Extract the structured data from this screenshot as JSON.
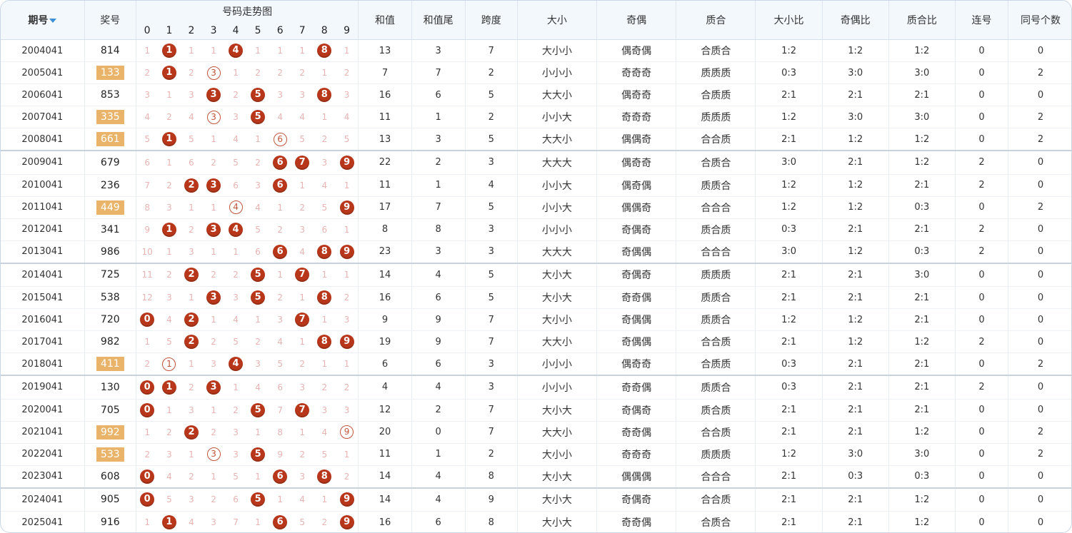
{
  "headers": {
    "period": "期号",
    "prize": "奖号",
    "trend": "号码走势图",
    "digits": [
      "0",
      "1",
      "2",
      "3",
      "4",
      "5",
      "6",
      "7",
      "8",
      "9"
    ],
    "sum": "和值",
    "sum_tail": "和值尾",
    "span": "跨度",
    "big_small": "大小",
    "odd_even": "奇偶",
    "prime_composite": "质合",
    "big_small_ratio": "大小比",
    "odd_even_ratio": "奇偶比",
    "prime_ratio": "质合比",
    "consecutive": "连号",
    "same_count": "同号个数"
  },
  "colors": {
    "ball": "#b8371a",
    "prize_highlight": "#e9b469",
    "header_bg": "#f3f8fd",
    "miss_text": "#e8b3b3"
  },
  "rows": [
    {
      "period": "2004041",
      "prize": "814",
      "hl": false,
      "cells": [
        "1",
        "1",
        "1",
        "1",
        "4",
        "1",
        "1",
        "1",
        "8",
        "1"
      ],
      "sum": "13",
      "tail": "3",
      "span": "7",
      "bs": "大小小",
      "oe": "偶奇偶",
      "pc": "合质合",
      "bsr": "1:2",
      "oer": "1:2",
      "pcr": "1:2",
      "cons": "0",
      "same": "0"
    },
    {
      "period": "2005041",
      "prize": "133",
      "hl": true,
      "cells": [
        "2",
        "1",
        "2",
        "3",
        "1",
        "2",
        "2",
        "2",
        "1",
        "2"
      ],
      "sum": "7",
      "tail": "7",
      "span": "2",
      "bs": "小小小",
      "oe": "奇奇奇",
      "pc": "质质质",
      "bsr": "0:3",
      "oer": "3:0",
      "pcr": "3:0",
      "cons": "0",
      "same": "2"
    },
    {
      "period": "2006041",
      "prize": "853",
      "hl": false,
      "cells": [
        "3",
        "1",
        "3",
        "3",
        "2",
        "5",
        "3",
        "3",
        "8",
        "3"
      ],
      "sum": "16",
      "tail": "6",
      "span": "5",
      "bs": "大大小",
      "oe": "偶奇奇",
      "pc": "合质质",
      "bsr": "2:1",
      "oer": "2:1",
      "pcr": "2:1",
      "cons": "0",
      "same": "0"
    },
    {
      "period": "2007041",
      "prize": "335",
      "hl": true,
      "cells": [
        "4",
        "2",
        "4",
        "3",
        "3",
        "5",
        "4",
        "4",
        "1",
        "4"
      ],
      "sum": "11",
      "tail": "1",
      "span": "2",
      "bs": "小小大",
      "oe": "奇奇奇",
      "pc": "质质质",
      "bsr": "1:2",
      "oer": "3:0",
      "pcr": "3:0",
      "cons": "0",
      "same": "2"
    },
    {
      "period": "2008041",
      "prize": "661",
      "hl": true,
      "cells": [
        "5",
        "1",
        "5",
        "1",
        "4",
        "1",
        "6",
        "5",
        "2",
        "5"
      ],
      "sum": "13",
      "tail": "3",
      "span": "5",
      "bs": "大大小",
      "oe": "偶偶奇",
      "pc": "合合质",
      "bsr": "2:1",
      "oer": "1:2",
      "pcr": "1:2",
      "cons": "0",
      "same": "2"
    },
    {
      "period": "2009041",
      "prize": "679",
      "hl": false,
      "cells": [
        "6",
        "1",
        "6",
        "2",
        "5",
        "2",
        "6",
        "7",
        "3",
        "9"
      ],
      "sum": "22",
      "tail": "2",
      "span": "3",
      "bs": "大大大",
      "oe": "偶奇奇",
      "pc": "合质合",
      "bsr": "3:0",
      "oer": "2:1",
      "pcr": "1:2",
      "cons": "2",
      "same": "0"
    },
    {
      "period": "2010041",
      "prize": "236",
      "hl": false,
      "cells": [
        "7",
        "2",
        "2",
        "3",
        "6",
        "3",
        "6",
        "1",
        "4",
        "1"
      ],
      "sum": "11",
      "tail": "1",
      "span": "4",
      "bs": "小小大",
      "oe": "偶奇偶",
      "pc": "质质合",
      "bsr": "1:2",
      "oer": "1:2",
      "pcr": "2:1",
      "cons": "2",
      "same": "0"
    },
    {
      "period": "2011041",
      "prize": "449",
      "hl": true,
      "cells": [
        "8",
        "3",
        "1",
        "1",
        "4",
        "4",
        "1",
        "2",
        "5",
        "9"
      ],
      "sum": "17",
      "tail": "7",
      "span": "5",
      "bs": "小小大",
      "oe": "偶偶奇",
      "pc": "合合合",
      "bsr": "1:2",
      "oer": "1:2",
      "pcr": "0:3",
      "cons": "0",
      "same": "2"
    },
    {
      "period": "2012041",
      "prize": "341",
      "hl": false,
      "cells": [
        "9",
        "1",
        "2",
        "3",
        "4",
        "5",
        "2",
        "3",
        "6",
        "1"
      ],
      "sum": "8",
      "tail": "8",
      "span": "3",
      "bs": "小小小",
      "oe": "奇偶奇",
      "pc": "质合质",
      "bsr": "0:3",
      "oer": "2:1",
      "pcr": "2:1",
      "cons": "2",
      "same": "0"
    },
    {
      "period": "2013041",
      "prize": "986",
      "hl": false,
      "cells": [
        "10",
        "1",
        "3",
        "1",
        "1",
        "6",
        "6",
        "4",
        "8",
        "9"
      ],
      "sum": "23",
      "tail": "3",
      "span": "3",
      "bs": "大大大",
      "oe": "奇偶偶",
      "pc": "合合合",
      "bsr": "3:0",
      "oer": "1:2",
      "pcr": "0:3",
      "cons": "2",
      "same": "0"
    },
    {
      "period": "2014041",
      "prize": "725",
      "hl": false,
      "cells": [
        "11",
        "2",
        "2",
        "2",
        "2",
        "5",
        "1",
        "7",
        "1",
        "1"
      ],
      "sum": "14",
      "tail": "4",
      "span": "5",
      "bs": "大小大",
      "oe": "奇偶奇",
      "pc": "质质质",
      "bsr": "2:1",
      "oer": "2:1",
      "pcr": "3:0",
      "cons": "0",
      "same": "0"
    },
    {
      "period": "2015041",
      "prize": "538",
      "hl": false,
      "cells": [
        "12",
        "3",
        "1",
        "3",
        "3",
        "5",
        "2",
        "1",
        "8",
        "2"
      ],
      "sum": "16",
      "tail": "6",
      "span": "5",
      "bs": "大小大",
      "oe": "奇奇偶",
      "pc": "质质合",
      "bsr": "2:1",
      "oer": "2:1",
      "pcr": "2:1",
      "cons": "0",
      "same": "0"
    },
    {
      "period": "2016041",
      "prize": "720",
      "hl": false,
      "cells": [
        "0",
        "4",
        "2",
        "1",
        "4",
        "1",
        "3",
        "7",
        "1",
        "3"
      ],
      "sum": "9",
      "tail": "9",
      "span": "7",
      "bs": "大小小",
      "oe": "奇偶偶",
      "pc": "质质合",
      "bsr": "1:2",
      "oer": "1:2",
      "pcr": "2:1",
      "cons": "0",
      "same": "0"
    },
    {
      "period": "2017041",
      "prize": "982",
      "hl": false,
      "cells": [
        "1",
        "5",
        "2",
        "2",
        "5",
        "2",
        "4",
        "1",
        "8",
        "9"
      ],
      "sum": "19",
      "tail": "9",
      "span": "7",
      "bs": "大大小",
      "oe": "奇偶偶",
      "pc": "合合质",
      "bsr": "2:1",
      "oer": "1:2",
      "pcr": "1:2",
      "cons": "2",
      "same": "0"
    },
    {
      "period": "2018041",
      "prize": "411",
      "hl": true,
      "cells": [
        "2",
        "1",
        "1",
        "3",
        "4",
        "3",
        "5",
        "2",
        "1",
        "1"
      ],
      "sum": "6",
      "tail": "6",
      "span": "3",
      "bs": "小小小",
      "oe": "偶奇奇",
      "pc": "合质质",
      "bsr": "0:3",
      "oer": "2:1",
      "pcr": "2:1",
      "cons": "0",
      "same": "2"
    },
    {
      "period": "2019041",
      "prize": "130",
      "hl": false,
      "cells": [
        "0",
        "1",
        "2",
        "3",
        "1",
        "4",
        "6",
        "3",
        "2",
        "2"
      ],
      "sum": "4",
      "tail": "4",
      "span": "3",
      "bs": "小小小",
      "oe": "奇奇偶",
      "pc": "质质合",
      "bsr": "0:3",
      "oer": "2:1",
      "pcr": "2:1",
      "cons": "2",
      "same": "0"
    },
    {
      "period": "2020041",
      "prize": "705",
      "hl": false,
      "cells": [
        "0",
        "1",
        "3",
        "1",
        "2",
        "5",
        "7",
        "7",
        "3",
        "3"
      ],
      "sum": "12",
      "tail": "2",
      "span": "7",
      "bs": "大小大",
      "oe": "奇偶奇",
      "pc": "质合质",
      "bsr": "2:1",
      "oer": "2:1",
      "pcr": "2:1",
      "cons": "0",
      "same": "0"
    },
    {
      "period": "2021041",
      "prize": "992",
      "hl": true,
      "cells": [
        "1",
        "2",
        "2",
        "2",
        "3",
        "1",
        "8",
        "1",
        "4",
        "9"
      ],
      "sum": "20",
      "tail": "0",
      "span": "7",
      "bs": "大大小",
      "oe": "奇奇偶",
      "pc": "合合质",
      "bsr": "2:1",
      "oer": "2:1",
      "pcr": "1:2",
      "cons": "0",
      "same": "2"
    },
    {
      "period": "2022041",
      "prize": "533",
      "hl": true,
      "cells": [
        "2",
        "3",
        "1",
        "3",
        "3",
        "5",
        "9",
        "2",
        "5",
        "1"
      ],
      "sum": "11",
      "tail": "1",
      "span": "2",
      "bs": "大小小",
      "oe": "奇奇奇",
      "pc": "质质质",
      "bsr": "1:2",
      "oer": "3:0",
      "pcr": "3:0",
      "cons": "0",
      "same": "2"
    },
    {
      "period": "2023041",
      "prize": "608",
      "hl": false,
      "cells": [
        "0",
        "4",
        "2",
        "1",
        "5",
        "1",
        "6",
        "3",
        "8",
        "2"
      ],
      "sum": "14",
      "tail": "4",
      "span": "8",
      "bs": "大小大",
      "oe": "偶偶偶",
      "pc": "合合合",
      "bsr": "2:1",
      "oer": "0:3",
      "pcr": "0:3",
      "cons": "0",
      "same": "0"
    },
    {
      "period": "2024041",
      "prize": "905",
      "hl": false,
      "cells": [
        "0",
        "5",
        "3",
        "2",
        "6",
        "5",
        "1",
        "4",
        "1",
        "9"
      ],
      "sum": "14",
      "tail": "4",
      "span": "9",
      "bs": "大小大",
      "oe": "奇偶奇",
      "pc": "合合质",
      "bsr": "2:1",
      "oer": "2:1",
      "pcr": "1:2",
      "cons": "0",
      "same": "0"
    },
    {
      "period": "2025041",
      "prize": "916",
      "hl": false,
      "cells": [
        "1",
        "1",
        "4",
        "3",
        "7",
        "1",
        "6",
        "5",
        "2",
        "9"
      ],
      "sum": "16",
      "tail": "6",
      "span": "8",
      "bs": "大小大",
      "oe": "奇奇偶",
      "pc": "合质合",
      "bsr": "2:1",
      "oer": "2:1",
      "pcr": "1:2",
      "cons": "0",
      "same": "0"
    }
  ],
  "marks": [
    {
      "b": [
        1,
        4,
        8
      ],
      "r": []
    },
    {
      "b": [
        1
      ],
      "r": [
        3
      ]
    },
    {
      "b": [
        3,
        5,
        8
      ],
      "r": []
    },
    {
      "b": [
        5
      ],
      "r": [
        3
      ]
    },
    {
      "b": [
        1
      ],
      "r": [
        6
      ]
    },
    {
      "b": [
        6,
        7,
        9
      ],
      "r": []
    },
    {
      "b": [
        2,
        3,
        6
      ],
      "r": []
    },
    {
      "b": [
        9
      ],
      "r": [
        4
      ]
    },
    {
      "b": [
        1,
        3,
        4
      ],
      "r": []
    },
    {
      "b": [
        6,
        8,
        9
      ],
      "r": []
    },
    {
      "b": [
        2,
        5,
        7
      ],
      "r": []
    },
    {
      "b": [
        3,
        5,
        8
      ],
      "r": []
    },
    {
      "b": [
        0,
        2,
        7
      ],
      "r": []
    },
    {
      "b": [
        2,
        8,
        9
      ],
      "r": []
    },
    {
      "b": [
        4
      ],
      "r": [
        1
      ]
    },
    {
      "b": [
        0,
        1,
        3
      ],
      "r": []
    },
    {
      "b": [
        0,
        5,
        7
      ],
      "r": []
    },
    {
      "b": [
        2
      ],
      "r": [
        9
      ]
    },
    {
      "b": [
        5
      ],
      "r": [
        3
      ]
    },
    {
      "b": [
        0,
        6,
        8
      ],
      "r": []
    },
    {
      "b": [
        0,
        5,
        9
      ],
      "r": []
    },
    {
      "b": [
        1,
        6,
        9
      ],
      "r": []
    }
  ]
}
